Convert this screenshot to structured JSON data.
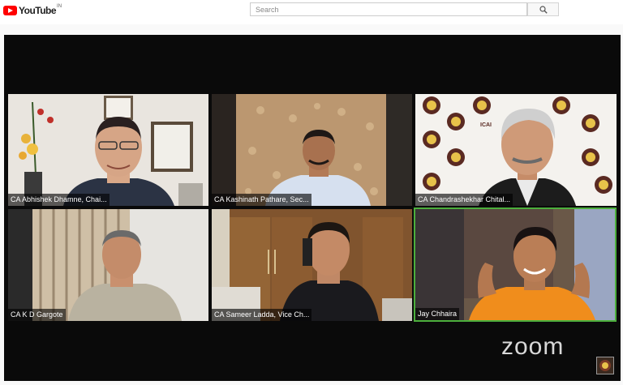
{
  "header": {
    "logo_text": "YouTube",
    "region": "IN",
    "search_placeholder": "Search"
  },
  "participants": [
    {
      "name": "CA Abhishek Dhamne, Chai..."
    },
    {
      "name": "CA Kashinath Pathare, Sec..."
    },
    {
      "name": "CA Chandrashekhar Chital..."
    },
    {
      "name": "CA K D Gargote"
    },
    {
      "name": "CA Sameer Ladda, Vice Ch..."
    },
    {
      "name": "Jay Chhaira"
    }
  ],
  "zoom_logo": "zoom",
  "icai_label": "ICAI",
  "colors": {
    "youtube_red": "#ff0000",
    "active_speaker": "#4caf3c"
  }
}
